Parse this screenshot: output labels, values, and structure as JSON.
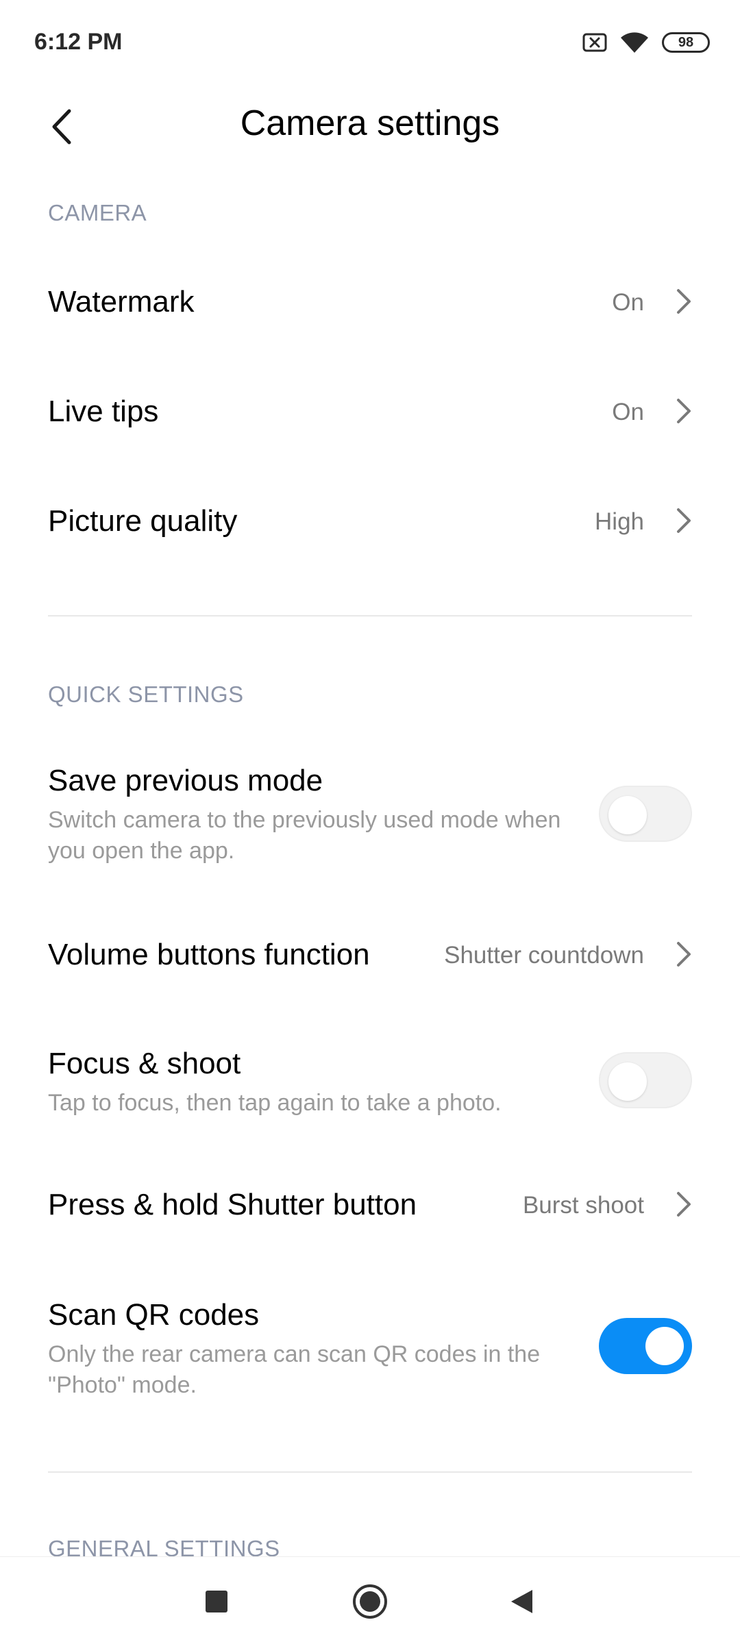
{
  "status_bar": {
    "time": "6:12 PM",
    "battery_level": "98",
    "icons": [
      "sim-x-icon",
      "wifi-icon",
      "battery-icon"
    ]
  },
  "header": {
    "title": "Camera settings",
    "back_icon": "chevron-left-icon"
  },
  "sections": {
    "camera": {
      "label": "CAMERA",
      "watermark": {
        "title": "Watermark",
        "value": "On"
      },
      "live_tips": {
        "title": "Live tips",
        "value": "On"
      },
      "picture_quality": {
        "title": "Picture quality",
        "value": "High"
      }
    },
    "quick_settings": {
      "label": "QUICK SETTINGS",
      "save_previous_mode": {
        "title": "Save previous mode",
        "description": "Switch camera to the previously used mode when you open the app.",
        "enabled": false
      },
      "volume_buttons_function": {
        "title": "Volume buttons function",
        "value": "Shutter countdown"
      },
      "focus_shoot": {
        "title": "Focus & shoot",
        "description": "Tap to focus, then tap again to take a photo.",
        "enabled": false
      },
      "press_hold_shutter": {
        "title": "Press & hold Shutter button",
        "value": "Burst shoot"
      },
      "scan_qr_codes": {
        "title": "Scan QR codes",
        "description": "Only the rear camera can scan QR codes in the \"Photo\" mode.",
        "enabled": true
      }
    },
    "general_settings": {
      "label": "GENERAL SETTINGS"
    }
  },
  "colors": {
    "accent": "#0a8df6",
    "section_label": "#8d95a8",
    "secondary_text": "#9a9a9a"
  },
  "nav_bar": {
    "icons": [
      "recents-square-icon",
      "home-circle-icon",
      "back-triangle-icon"
    ]
  }
}
